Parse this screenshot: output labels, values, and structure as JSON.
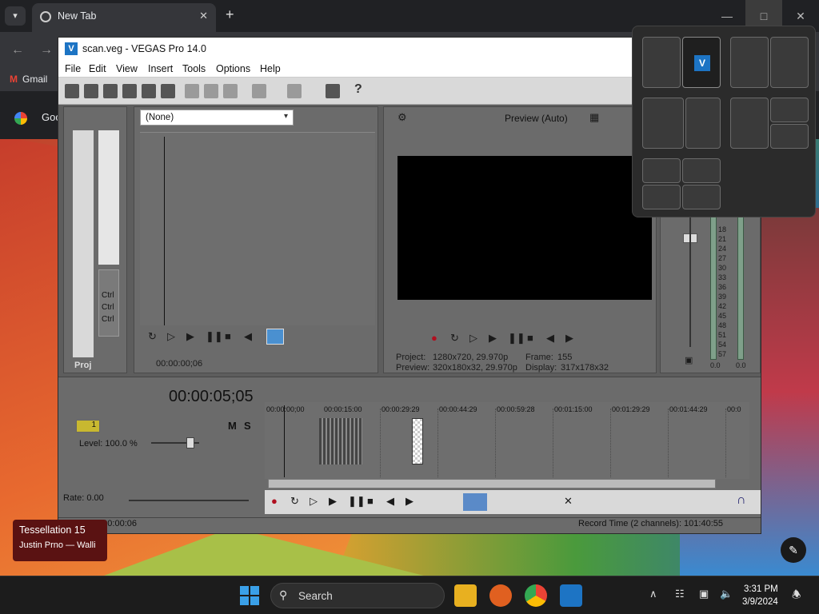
{
  "browser": {
    "tab_title": "New Tab",
    "bookmark_gmail": "Gmail",
    "google_link": "Goo"
  },
  "vegas": {
    "title": "scan.veg - VEGAS Pro 14.0",
    "menu": [
      "File",
      "Edit",
      "View",
      "Insert",
      "Tools",
      "Options",
      "Help"
    ],
    "fx_dropdown": "(None)",
    "preview_quality": "Preview (Auto)",
    "project_label": "Project:",
    "project_value": "1280x720, 29.970p",
    "preview_label": "Preview:",
    "preview_value": "320x180x32, 29.970p",
    "frame_label": "Frame:",
    "frame_value": "155",
    "display_label": "Display:",
    "display_value": "317x178x32",
    "trimmer_time": "00:00:00;06",
    "timecode": "00:00:05;05",
    "ruler": [
      "00:00:00;00",
      "00:00:15:00",
      "00:00:29:29",
      "00:00:44:29",
      "00:00:59:28",
      "00:01:15:00",
      "00:01:29:29",
      "00:01:44:29",
      "00:0"
    ],
    "track_number": "1",
    "track_level": "Level: 100.0 %",
    "track_m": "M",
    "track_s": "S",
    "rate": "Rate: 0.00",
    "status_complete": "Complete: 00:00:06",
    "status_record": "Record Time (2 channels): 101:40:55",
    "proj_tab": "Proj",
    "ctrl": [
      "Ctrl",
      "Ctrl",
      "Ctrl"
    ],
    "meter_scale": [
      "18",
      "21",
      "24",
      "27",
      "30",
      "33",
      "36",
      "39",
      "42",
      "45",
      "48",
      "51",
      "54",
      "57"
    ],
    "meter_values": [
      "0.0",
      "0.0"
    ]
  },
  "notification": {
    "title": "Tessellation 15",
    "artist": "Justin Prno — Walli"
  },
  "taskbar": {
    "search_label": "Search",
    "time": "3:31 PM",
    "date": "3/9/2024"
  },
  "colors": {
    "accent": "#3aa0e8",
    "vegas_panel": "#6b6b6b",
    "taskbar": "#1c1c1c"
  }
}
